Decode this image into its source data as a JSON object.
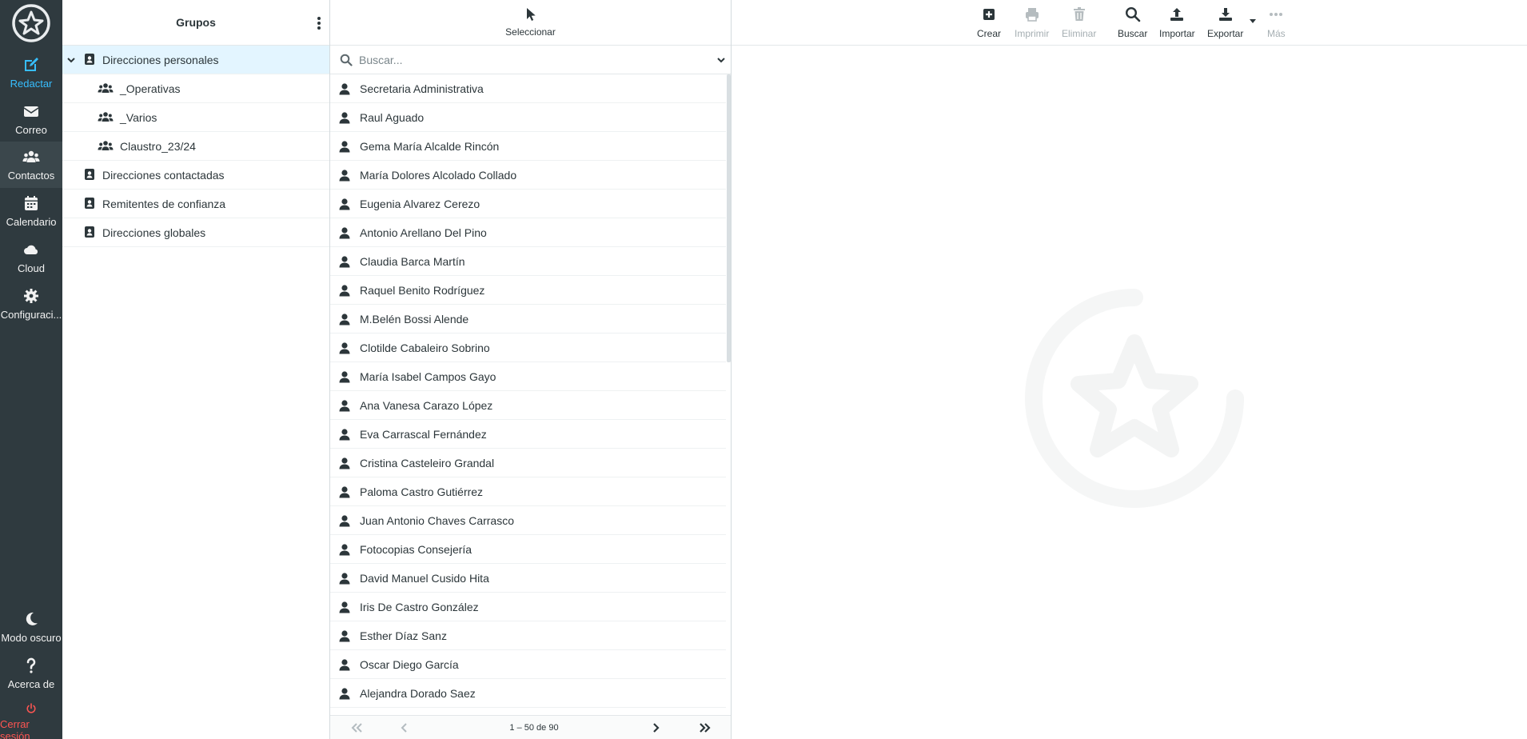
{
  "nav": {
    "items": [
      {
        "label": "Redactar",
        "icon": "compose-icon"
      },
      {
        "label": "Correo",
        "icon": "mail-icon"
      },
      {
        "label": "Contactos",
        "icon": "contacts-icon"
      },
      {
        "label": "Calendario",
        "icon": "calendar-icon"
      },
      {
        "label": "Cloud",
        "icon": "cloud-icon"
      },
      {
        "label": "Configuraci...",
        "icon": "gear-icon"
      }
    ],
    "bottom": [
      {
        "label": "Modo oscuro",
        "icon": "moon-icon"
      },
      {
        "label": "Acerca de",
        "icon": "question-icon"
      },
      {
        "label": "Cerrar sesión",
        "icon": "power-icon"
      }
    ]
  },
  "groups": {
    "title": "Grupos",
    "items": [
      {
        "label": "Direcciones personales"
      },
      {
        "label": "_Operativas"
      },
      {
        "label": "_Varios"
      },
      {
        "label": "Claustro_23/24"
      },
      {
        "label": "Direcciones contactadas"
      },
      {
        "label": "Remitentes de confianza"
      },
      {
        "label": "Direcciones globales"
      }
    ]
  },
  "list": {
    "select_label": "Seleccionar",
    "search_placeholder": "Buscar...",
    "contacts": [
      "Secretaria Administrativa",
      "Raul Aguado",
      "Gema María Alcalde Rincón",
      "María Dolores Alcolado Collado",
      "Eugenia Alvarez Cerezo",
      "Antonio Arellano Del Pino",
      "Claudia Barca Martín",
      "Raquel Benito Rodríguez",
      "M.Belén Bossi Alende",
      "Clotilde Cabaleiro Sobrino",
      "María Isabel Campos Gayo",
      "Ana Vanesa Carazo López",
      "Eva Carrascal Fernández",
      "Cristina Casteleiro Grandal",
      "Paloma Castro Gutiérrez",
      "Juan Antonio Chaves Carrasco",
      "Fotocopias Consejería",
      "David Manuel Cusido Hita",
      "Iris De Castro González",
      "Esther Díaz Sanz",
      "Oscar Diego García",
      "Alejandra Dorado Saez"
    ],
    "pager": {
      "count": "1 – 50 de 90"
    }
  },
  "toolbar": {
    "create": "Crear",
    "print": "Imprimir",
    "delete": "Eliminar",
    "search": "Buscar",
    "import": "Importar",
    "export": "Exportar",
    "more": "Más"
  },
  "colors": {
    "rail": "#2f3a3f",
    "accent": "#37beff",
    "logout": "#ff5552",
    "selected_group": "#e3f5ff"
  }
}
